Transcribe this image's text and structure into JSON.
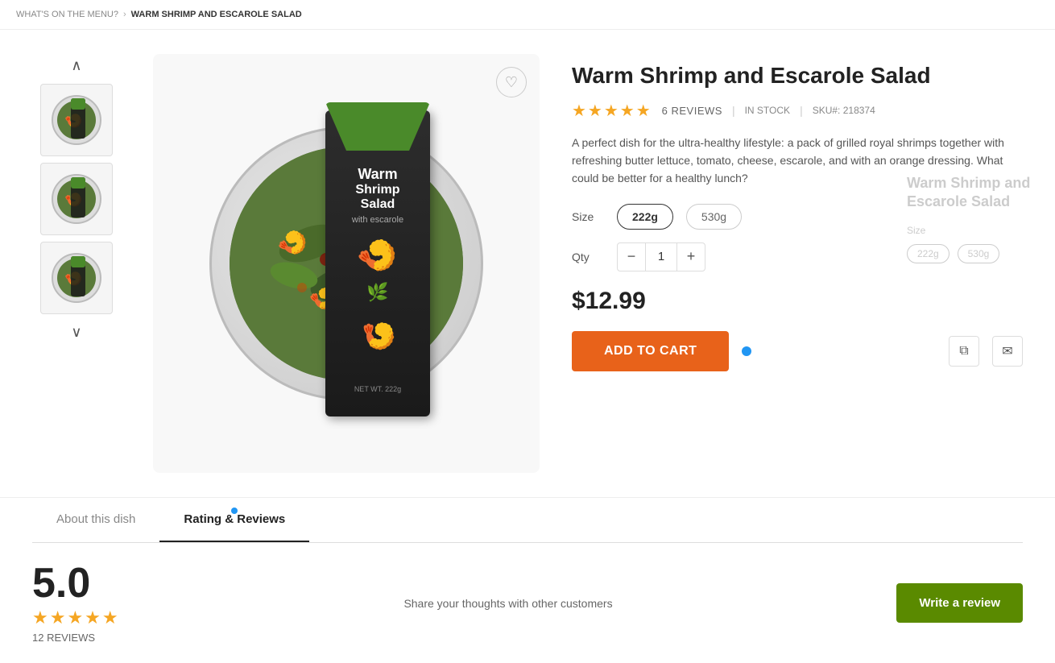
{
  "breadcrumb": {
    "parent_label": "WHAT'S ON THE MENU?",
    "separator": "›",
    "current": "WARM SHRIMP AND ESCAROLE SALAD"
  },
  "product": {
    "title": "Warm Shrimp and Escarole Salad",
    "stars": "★★★★★",
    "reviews_count": "6 REVIEWS",
    "stock_status": "IN STOCK",
    "sku_label": "SKU#:",
    "sku": "218374",
    "description": "A perfect dish for the ultra-healthy lifestyle: a pack of grilled royal shrimps together with refreshing butter lettuce, tomato, cheese, escarole, and with an orange dressing. What could be better for a healthy lunch?",
    "size_label": "Size",
    "sizes": [
      "222g",
      "530g"
    ],
    "selected_size": "222g",
    "qty_label": "Qty",
    "qty": "1",
    "price": "$12.99",
    "add_to_cart_label": "Add To Cart",
    "package_title_line1": "Warm",
    "package_title_line2": "Shrimp",
    "package_title_line3": "Salad",
    "package_subtitle": "with escarole",
    "net_weight": "NET WT. 222g"
  },
  "tabs": {
    "items": [
      {
        "id": "about",
        "label": "About this dish",
        "active": false,
        "has_dot": false
      },
      {
        "id": "rating",
        "label": "Rating & Reviews",
        "active": true,
        "has_dot": true
      }
    ]
  },
  "reviews": {
    "overall_rating": "5.0",
    "stars": "★★★★★",
    "count_label": "12 REVIEWS",
    "share_prompt": "Share your thoughts with other customers",
    "write_review_label": "Write a review"
  },
  "sidebar": {
    "product_title": "Warm Shrimp and Escarole Salad",
    "size_label": "Size",
    "sizes": [
      "222g",
      "530g"
    ]
  },
  "icons": {
    "wishlist": "♡",
    "up_arrow": "∧",
    "down_arrow": "∨",
    "copy": "⧉",
    "mail": "✉"
  }
}
